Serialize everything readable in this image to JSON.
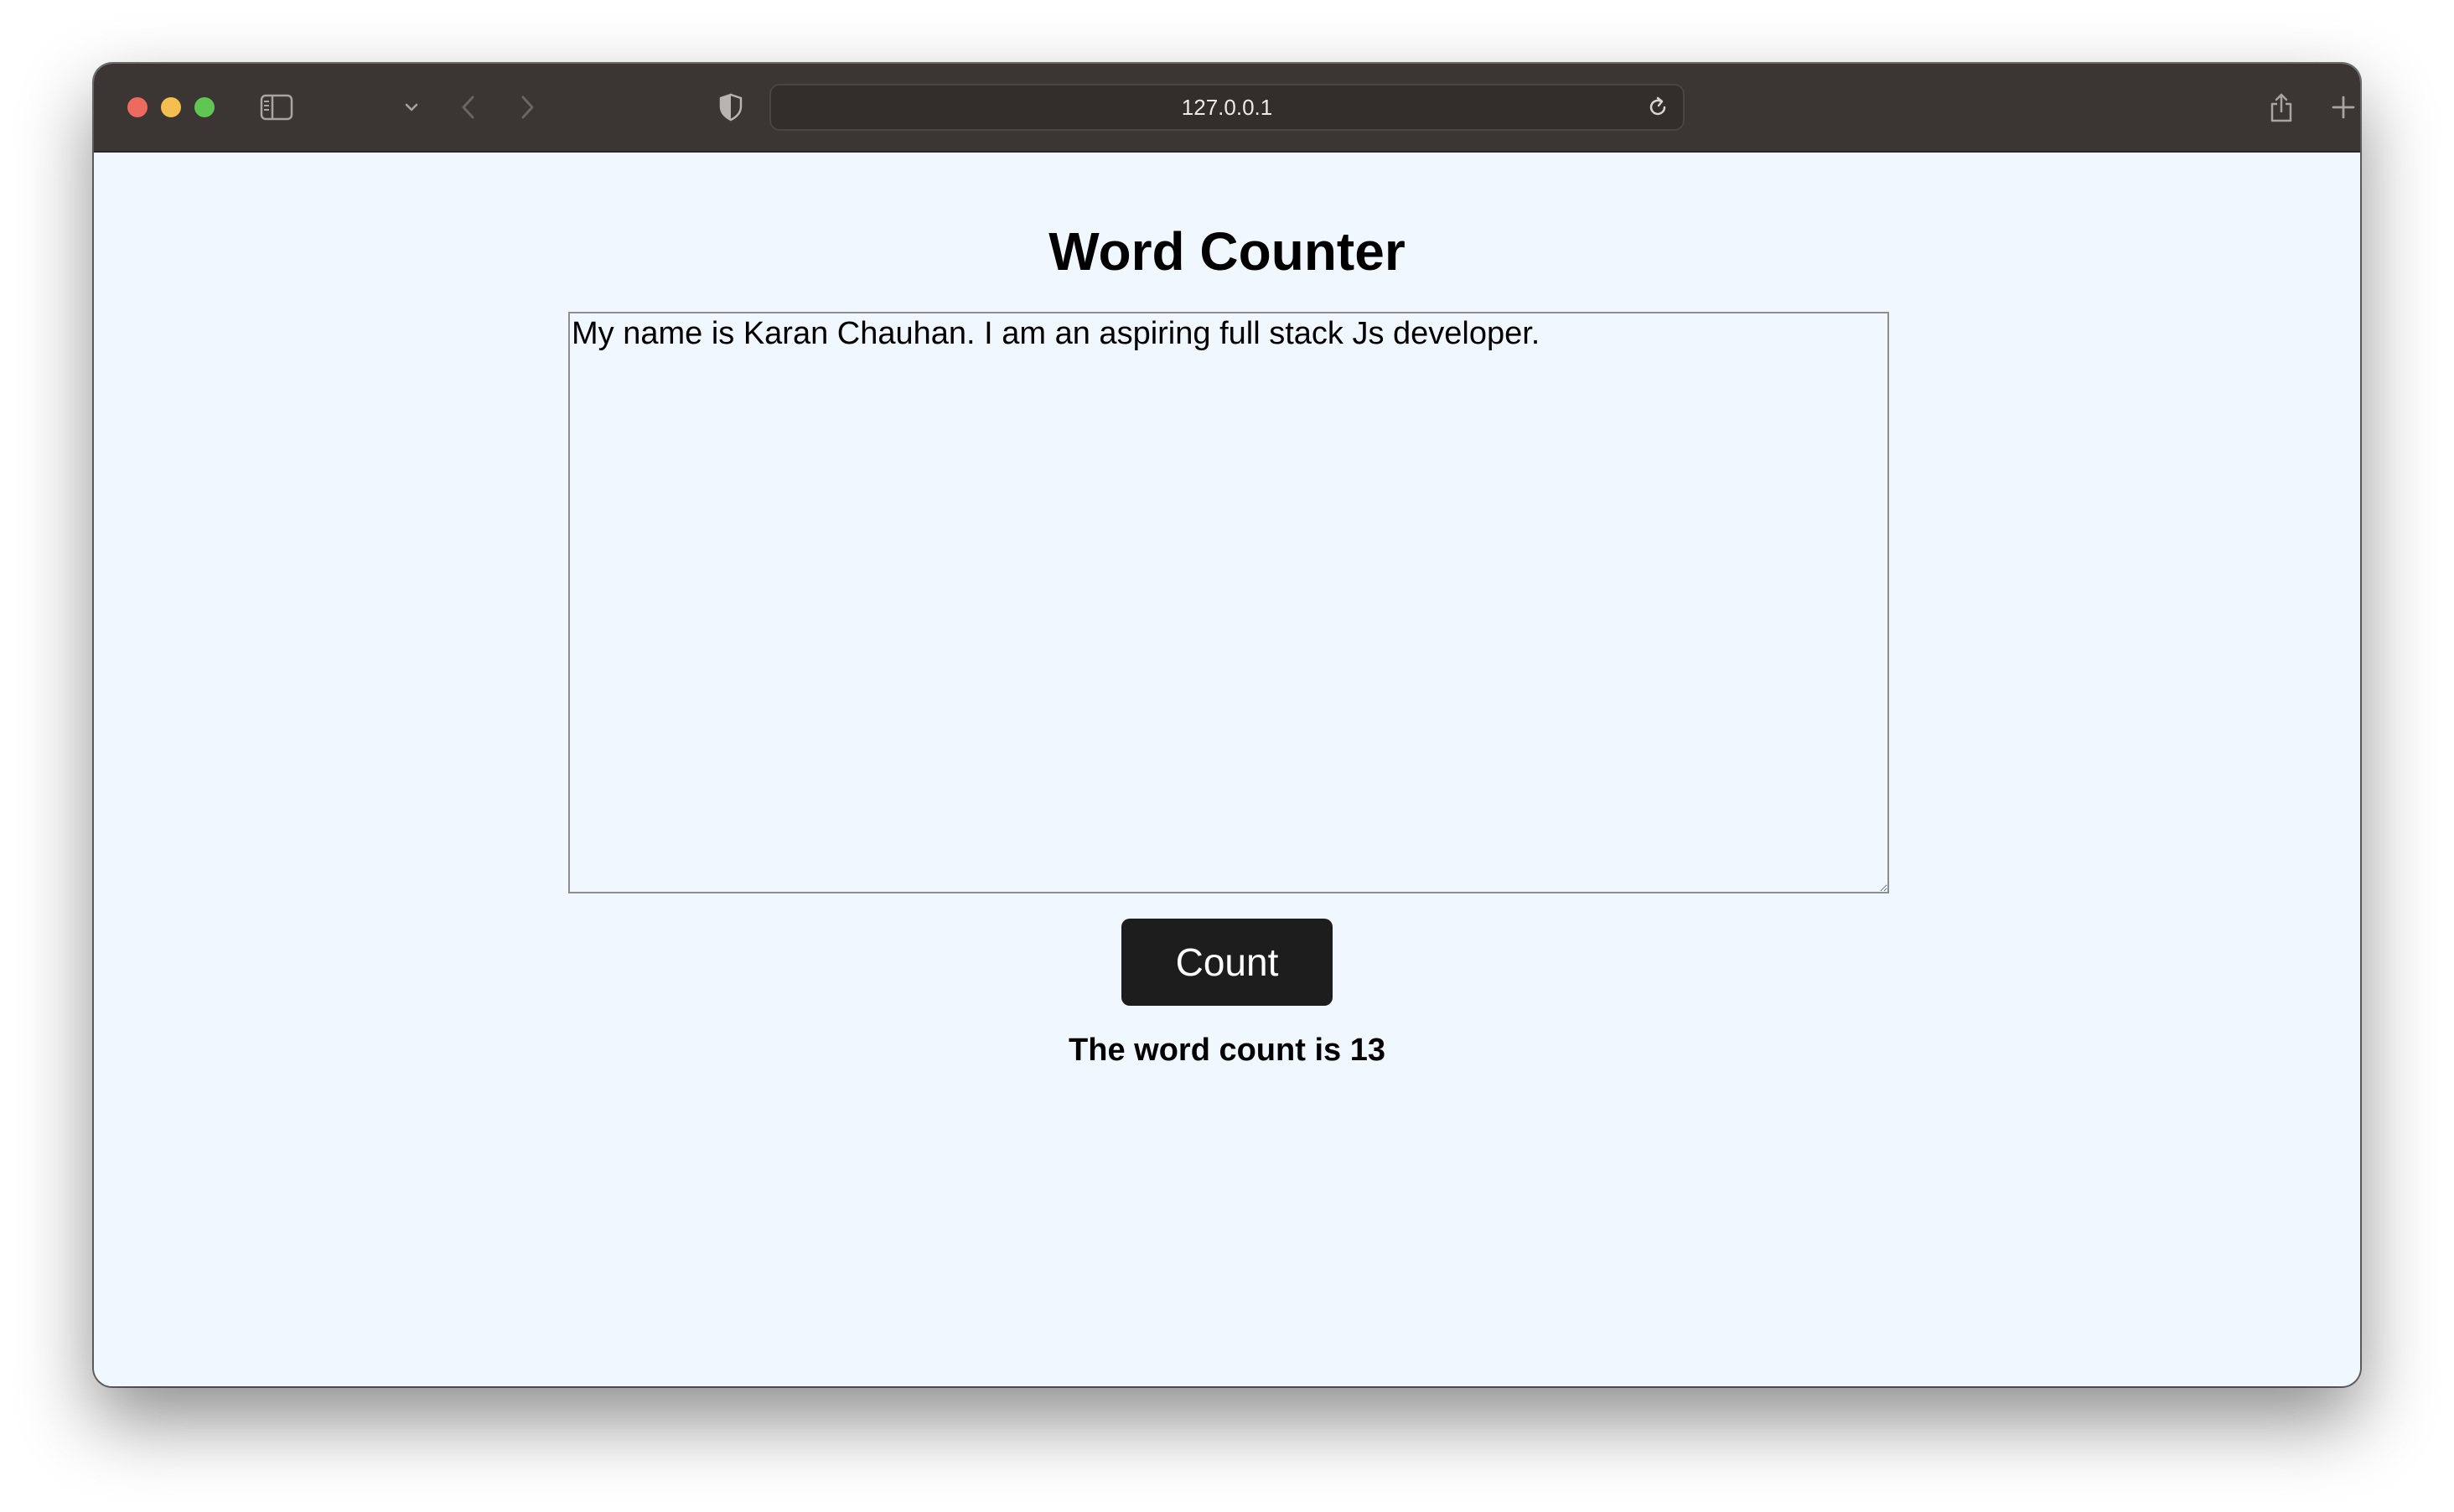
{
  "browser": {
    "url": "127.0.0.1",
    "icons": {
      "close": "close-button",
      "minimize": "minimize-button",
      "maximize": "zoom-button",
      "sidebar": "sidebar-icon",
      "sidebar_menu": "chevron-down-icon",
      "back": "chevron-left-icon",
      "forward": "chevron-right-icon",
      "privacy": "shield-icon",
      "reload": "reload-icon",
      "share": "share-icon",
      "new_tab": "plus-icon",
      "tab_overview": "tabs-icon"
    },
    "colors": {
      "toolbar": "#3b3533",
      "traffic_close": "#ed6a5e",
      "traffic_min": "#f5bf4f",
      "traffic_max": "#61c554"
    }
  },
  "page": {
    "title": "Word Counter",
    "textarea_value": "My name is Karan Chauhan. I am an aspiring full stack Js developer.",
    "button_label": "Count",
    "result_text": "The word count is 13",
    "colors": {
      "background": "#f0f7fe",
      "button_bg": "#1d1d1d",
      "button_text": "#ffffff"
    }
  }
}
